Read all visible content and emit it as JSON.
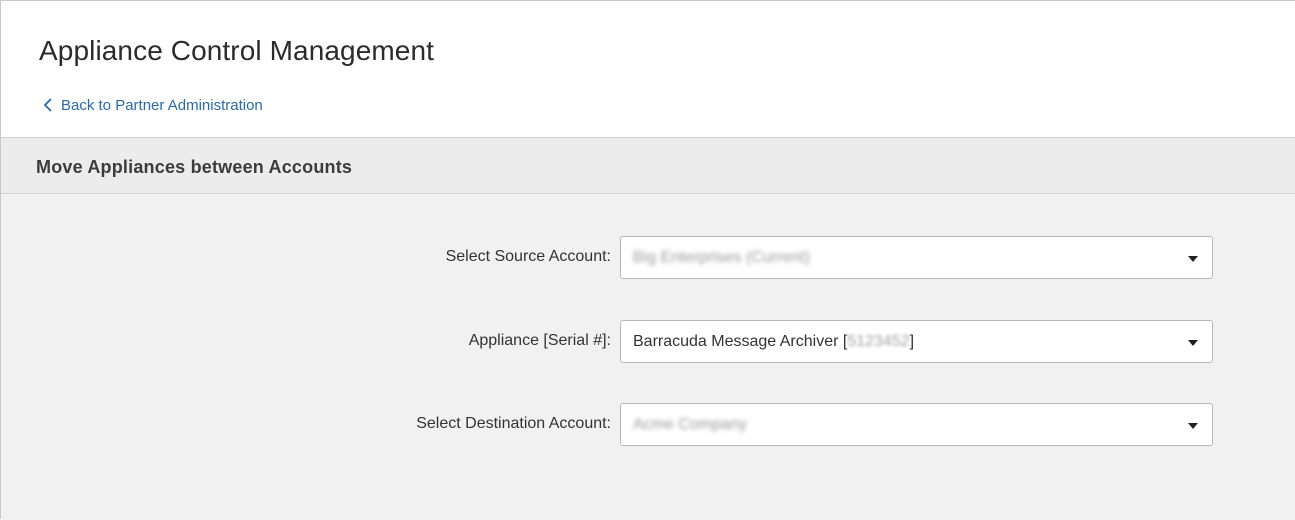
{
  "header": {
    "title": "Appliance Control Management",
    "back_link": "Back to Partner Administration"
  },
  "section": {
    "title": "Move Appliances between Accounts",
    "fields": [
      {
        "label": "Select Source Account:",
        "value": "Big Enterprises (Current)",
        "redacted": true
      },
      {
        "label": "Appliance [Serial #]:",
        "value_prefix": "Barracuda Message Archiver [",
        "value_redacted": "5123452",
        "value_suffix": "]"
      },
      {
        "label": "Select Destination Account:",
        "value": "Acme Company",
        "redacted": true
      }
    ]
  },
  "icons": {
    "back": "chevron-left-icon",
    "dropdown": "caret-down-icon"
  },
  "colors": {
    "link": "#2a6aa8",
    "section_bg": "#f1f1f1",
    "header_bg": "#ffffff"
  }
}
